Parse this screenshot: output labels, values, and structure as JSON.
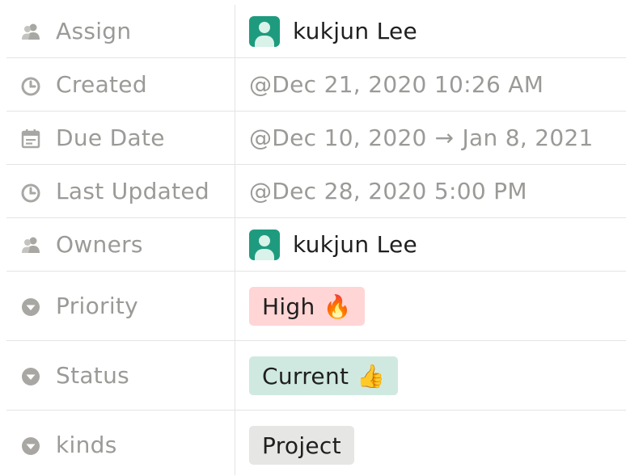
{
  "properties": {
    "assign": {
      "label": "Assign",
      "value": "kukjun Lee"
    },
    "created": {
      "label": "Created",
      "value": "@Dec 21, 2020 10:26 AM"
    },
    "due_date": {
      "label": "Due Date",
      "start": "@Dec 10, 2020",
      "arrow": "→",
      "end": "Jan 8, 2021"
    },
    "last_updated": {
      "label": "Last Updated",
      "value": "@Dec 28, 2020 5:00 PM"
    },
    "owners": {
      "label": "Owners",
      "value": "kukjun Lee"
    },
    "priority": {
      "label": "Priority",
      "value": "High",
      "emoji": "🔥",
      "color": "#ffd5d5"
    },
    "status": {
      "label": "Status",
      "value": "Current",
      "emoji": "👍",
      "color": "#cfe9e1"
    },
    "kinds": {
      "label": "kinds",
      "value": "Project",
      "color": "#e6e6e4"
    }
  },
  "colors": {
    "avatar": "#1e9b7e",
    "muted_text": "#9b9a97",
    "divider": "#e4e4e2"
  }
}
